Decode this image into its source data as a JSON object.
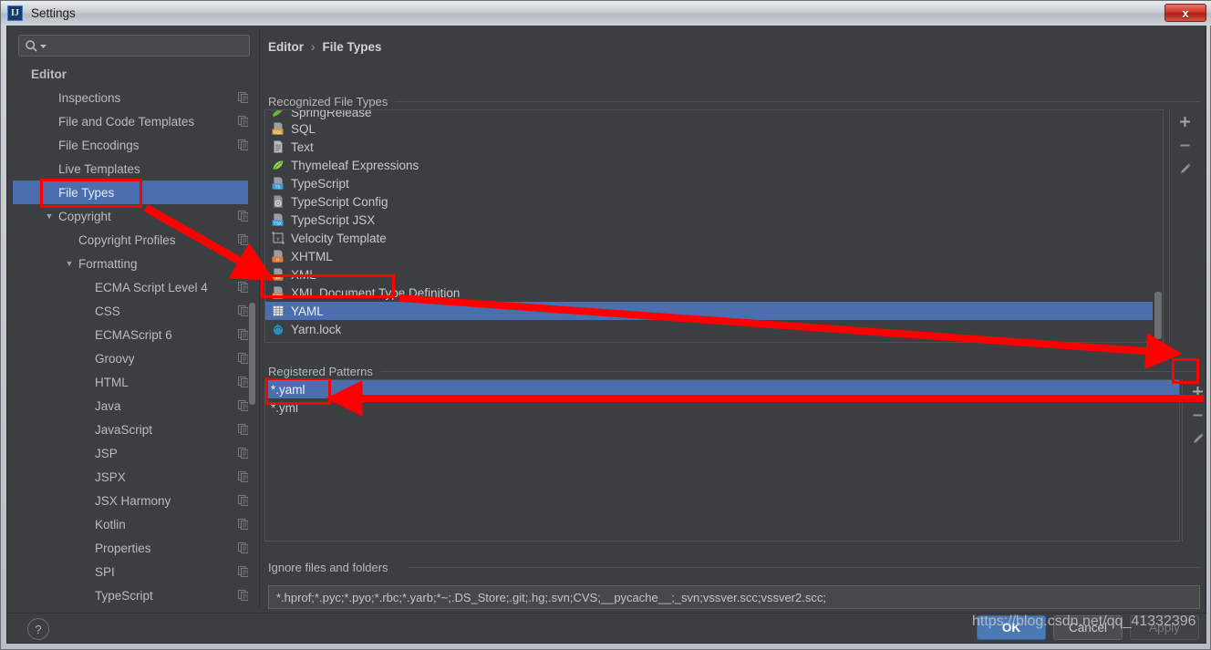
{
  "window": {
    "title": "Settings",
    "app_icon": "intellij-idea-icon",
    "close_label": "x"
  },
  "search": {
    "value": "",
    "placeholder": "",
    "icon": "search-icon",
    "dropdown_icon": "chevron-down-icon"
  },
  "sidebar": {
    "items": [
      {
        "label": "Editor",
        "indent": 0,
        "bold": true,
        "arrow": "",
        "copy": false,
        "selected": false
      },
      {
        "label": "Inspections",
        "indent": 1,
        "bold": false,
        "arrow": "",
        "copy": true,
        "selected": false
      },
      {
        "label": "File and Code Templates",
        "indent": 1,
        "bold": false,
        "arrow": "",
        "copy": true,
        "selected": false
      },
      {
        "label": "File Encodings",
        "indent": 1,
        "bold": false,
        "arrow": "",
        "copy": true,
        "selected": false
      },
      {
        "label": "Live Templates",
        "indent": 1,
        "bold": false,
        "arrow": "",
        "copy": false,
        "selected": false
      },
      {
        "label": "File Types",
        "indent": 1,
        "bold": false,
        "arrow": "",
        "copy": false,
        "selected": true
      },
      {
        "label": "Copyright",
        "indent": 1,
        "bold": false,
        "arrow": "▼",
        "copy": true,
        "selected": false
      },
      {
        "label": "Copyright Profiles",
        "indent": 2,
        "bold": false,
        "arrow": "",
        "copy": true,
        "selected": false
      },
      {
        "label": "Formatting",
        "indent": 2,
        "bold": false,
        "arrow": "▼",
        "copy": true,
        "selected": false
      },
      {
        "label": "ECMA Script Level 4",
        "indent": 3,
        "bold": false,
        "arrow": "",
        "copy": true,
        "selected": false
      },
      {
        "label": "CSS",
        "indent": 3,
        "bold": false,
        "arrow": "",
        "copy": true,
        "selected": false
      },
      {
        "label": "ECMAScript 6",
        "indent": 3,
        "bold": false,
        "arrow": "",
        "copy": true,
        "selected": false
      },
      {
        "label": "Groovy",
        "indent": 3,
        "bold": false,
        "arrow": "",
        "copy": true,
        "selected": false
      },
      {
        "label": "HTML",
        "indent": 3,
        "bold": false,
        "arrow": "",
        "copy": true,
        "selected": false
      },
      {
        "label": "Java",
        "indent": 3,
        "bold": false,
        "arrow": "",
        "copy": true,
        "selected": false
      },
      {
        "label": "JavaScript",
        "indent": 3,
        "bold": false,
        "arrow": "",
        "copy": true,
        "selected": false
      },
      {
        "label": "JSP",
        "indent": 3,
        "bold": false,
        "arrow": "",
        "copy": true,
        "selected": false
      },
      {
        "label": "JSPX",
        "indent": 3,
        "bold": false,
        "arrow": "",
        "copy": true,
        "selected": false
      },
      {
        "label": "JSX Harmony",
        "indent": 3,
        "bold": false,
        "arrow": "",
        "copy": true,
        "selected": false
      },
      {
        "label": "Kotlin",
        "indent": 3,
        "bold": false,
        "arrow": "",
        "copy": true,
        "selected": false
      },
      {
        "label": "Properties",
        "indent": 3,
        "bold": false,
        "arrow": "",
        "copy": true,
        "selected": false
      },
      {
        "label": "SPI",
        "indent": 3,
        "bold": false,
        "arrow": "",
        "copy": true,
        "selected": false
      },
      {
        "label": "TypeScript",
        "indent": 3,
        "bold": false,
        "arrow": "",
        "copy": true,
        "selected": false
      }
    ]
  },
  "breadcrumb": {
    "root": "Editor",
    "separator": "›",
    "leaf": "File Types"
  },
  "recognized_file_types": {
    "group_label": "Recognized File Types",
    "rows": [
      {
        "label": "SpringRelease",
        "icon": "spring-icon",
        "selected": false,
        "clipped": true
      },
      {
        "label": "SQL",
        "icon": "sql-icon",
        "selected": false
      },
      {
        "label": "Text",
        "icon": "text-icon",
        "selected": false
      },
      {
        "label": "Thymeleaf Expressions",
        "icon": "thymeleaf-icon",
        "selected": false
      },
      {
        "label": "TypeScript",
        "icon": "ts-icon",
        "selected": false
      },
      {
        "label": "TypeScript Config",
        "icon": "tsconfig-icon",
        "selected": false
      },
      {
        "label": "TypeScript JSX",
        "icon": "tsx-icon",
        "selected": false
      },
      {
        "label": "Velocity Template",
        "icon": "velocity-icon",
        "selected": false
      },
      {
        "label": "XHTML",
        "icon": "xhtml-icon",
        "selected": false
      },
      {
        "label": "XML",
        "icon": "xml-icon",
        "selected": false
      },
      {
        "label": "XML Document Type Definition",
        "icon": "dtd-icon",
        "selected": false
      },
      {
        "label": "YAML",
        "icon": "yaml-icon",
        "selected": true
      },
      {
        "label": "Yarn.lock",
        "icon": "yarn-icon",
        "selected": false
      }
    ],
    "toolbar": [
      {
        "name": "add-file-type-button",
        "icon": "plus-icon",
        "label": "+"
      },
      {
        "name": "remove-file-type-button",
        "icon": "minus-icon",
        "label": "−"
      },
      {
        "name": "edit-file-type-button",
        "icon": "pencil-icon",
        "label": "✎"
      }
    ]
  },
  "registered_patterns": {
    "group_label": "Registered Patterns",
    "rows": [
      {
        "pattern": "*.yaml",
        "selected": true
      },
      {
        "pattern": "*.yml",
        "selected": false
      }
    ],
    "toolbar": [
      {
        "name": "add-pattern-button",
        "icon": "plus-icon",
        "label": "+"
      },
      {
        "name": "remove-pattern-button",
        "icon": "minus-icon",
        "label": "−"
      },
      {
        "name": "edit-pattern-button",
        "icon": "pencil-icon",
        "label": "✎"
      }
    ]
  },
  "ignore": {
    "group_label": "Ignore files and folders",
    "value": "*.hprof;*.pyc;*.pyo;*.rbc;*.yarb;*~;.DS_Store;.git;.hg;.svn;CVS;__pycache__;_svn;vssver.scc;vssver2.scc;"
  },
  "footer": {
    "help_label": "?",
    "ok_label": "OK",
    "cancel_label": "Cancel",
    "apply_label": "Apply"
  },
  "watermark": "https://blog.csdn.net/qq_41332396",
  "annotations": {
    "color": "#ff0000",
    "highlights": [
      "sidebar-file-types-highlight",
      "yaml-row-highlight",
      "yml-pattern-highlight",
      "add-pattern-button-highlight"
    ],
    "arrows": [
      "arrow-sidebar-to-yaml",
      "arrow-add-pattern-to-yaml",
      "arrow-yml-pattern"
    ]
  },
  "colors": {
    "accent_selection": "#4b6eaf",
    "panel_bg": "#3c3f41",
    "field_bg": "#45494a",
    "annotation_red": "#ff0000",
    "ok_button": "#4a7ab5"
  }
}
